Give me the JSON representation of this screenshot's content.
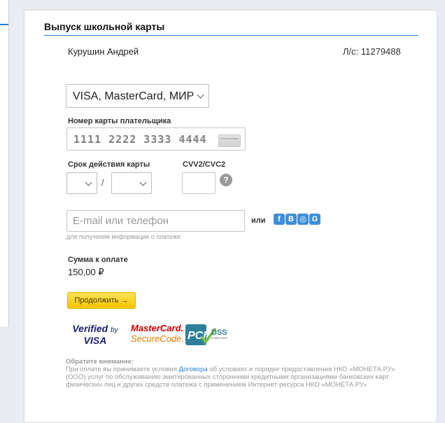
{
  "header": {
    "title": "Выпуск школьной карты"
  },
  "payer": {
    "name": "Курушин Андрей",
    "account": "Л/с: 11279488"
  },
  "payment_method": {
    "selected": "VISA, MasterCard, МИР"
  },
  "card": {
    "label": "Номер карты плательщика",
    "number": "1111 2222 3333 4444"
  },
  "expiry": {
    "label": "Срок действия карты",
    "separator": "/",
    "month": "",
    "year": ""
  },
  "cvv": {
    "label": "CVV2/CVC2",
    "help_symbol": "?"
  },
  "contact": {
    "placeholder": "E-mail или телефон",
    "or_label": "или",
    "hint": "для получения информации о платеже",
    "social": [
      "f",
      "В",
      "◎",
      "G"
    ]
  },
  "amount": {
    "label": "Сумма к оплате",
    "value": "150,00 ₽"
  },
  "buttons": {
    "continue": "Продолжить →"
  },
  "logos": {
    "visa_top": "Verified",
    "visa_by": "by",
    "visa_bottom": "VISA",
    "mc_top": "MasterCard.",
    "mc_bottom": "SecureCode.",
    "pci": "PCI",
    "dss": "DSS",
    "compliant": "COMPLIANT"
  },
  "notice": {
    "title": "Обратите внимание:",
    "before_link": "При оплате вы принимаете условия ",
    "link": "Договора",
    "after_link": " об условиях и порядке предоставления НКО «МОНЕТА.РУ» (ООО) услуг по обслуживанию эмитированных сторонними кредитными организациями банковских карт физических лиц и других средств платежа с применением Интернет-ресурса НКО «МОНЕТА.РУ»"
  },
  "colors": {
    "accent": "#2d7fd0",
    "button": "#f5c400",
    "social": "#3f8fd8"
  }
}
